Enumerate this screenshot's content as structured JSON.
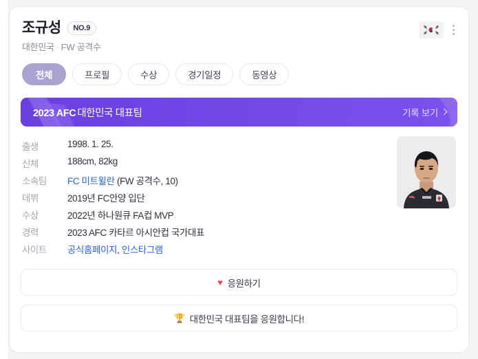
{
  "header": {
    "player_name": "조규성",
    "jersey_badge": "NO.9",
    "nationality": "대한민국",
    "separator": "·",
    "position": "FW 공격수",
    "flag_icon": "south-korea-flag-icon",
    "menu_icon": "kebab-menu-icon"
  },
  "tabs": [
    {
      "label": "전체",
      "active": true
    },
    {
      "label": "프로필",
      "active": false
    },
    {
      "label": "수상",
      "active": false
    },
    {
      "label": "경기일정",
      "active": false
    },
    {
      "label": "동영상",
      "active": false
    }
  ],
  "banner": {
    "title_strong": "2023 AFC",
    "title_rest": "대한민국 대표팀",
    "link_label": "기록 보기",
    "chevron_icon": "chevron-right-icon",
    "background_color": "#7048e6"
  },
  "profile": {
    "rows": [
      {
        "label": "출생",
        "value": "1998. 1. 25."
      },
      {
        "label": "신체",
        "value": "188cm, 82kg"
      },
      {
        "label": "소속팀",
        "link": "FC 미트윌란",
        "value": " (FW 공격수, 10)"
      },
      {
        "label": "데뷔",
        "value": "2019년 FC안양 입단"
      },
      {
        "label": "수상",
        "value": "2022년 하나원큐 FA컵 MVP"
      },
      {
        "label": "경력",
        "value": "2023 AFC 카타르 아시안컵 국가대표"
      },
      {
        "label": "사이트",
        "link": "공식홈페이지",
        "link2": "인스타그램",
        "sep": ", "
      }
    ],
    "photo_alt": "player-portrait"
  },
  "actions": [
    {
      "icon": "heart-icon",
      "glyph": "♥",
      "label": "응원하기"
    },
    {
      "icon": "trophy-icon",
      "glyph": "🏆",
      "label": "대한민국 대표팀을 응원합니다!"
    }
  ],
  "colors": {
    "accent_purple": "#7048e6",
    "tab_active": "#a9a3d2",
    "link_blue": "#2b62d9",
    "heart_red": "#f4464e"
  }
}
